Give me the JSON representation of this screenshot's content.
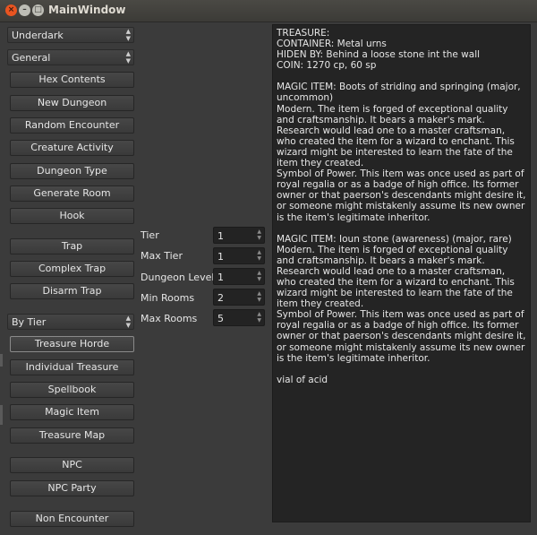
{
  "window": {
    "title": "MainWindow",
    "close_glyph": "×",
    "min_glyph": "–",
    "max_glyph": "□"
  },
  "combos": {
    "region": "Underdark",
    "category": "General",
    "treasure_mode": "By Tier"
  },
  "buttons": {
    "hex_contents": "Hex Contents",
    "new_dungeon": "New Dungeon",
    "random_encounter": "Random Encounter",
    "creature_activity": "Creature Activity",
    "dungeon_type": "Dungeon Type",
    "generate_room": "Generate Room",
    "hook": "Hook",
    "trap": "Trap",
    "complex_trap": "Complex Trap",
    "disarm_trap": "Disarm Trap",
    "treasure_horde": "Treasure Horde",
    "individual_treasure": "Individual Treasure",
    "spellbook": "Spellbook",
    "magic_item": "Magic Item",
    "treasure_map": "Treasure Map",
    "npc": "NPC",
    "npc_party": "NPC Party",
    "non_encounter": "Non Encounter"
  },
  "params": {
    "tier": {
      "label": "Tier",
      "value": "1"
    },
    "max_tier": {
      "label": "Max Tier",
      "value": "1"
    },
    "dungeon_levels": {
      "label": "Dungeon Levels",
      "value": "1"
    },
    "min_rooms": {
      "label": "Min Rooms",
      "value": "2"
    },
    "max_rooms": {
      "label": "Max Rooms",
      "value": "5"
    }
  },
  "output": {
    "lines": [
      "TREASURE:",
      "CONTAINER: Metal urns",
      "HIDEN BY: Behind a loose stone int the wall",
      "COIN: 1270 cp, 60 sp",
      "",
      "MAGIC ITEM: Boots of striding and springing (major, uncommon)",
      "Modern. The item is forged of exceptional quality and craftsmanship. It bears a maker's mark. Research would lead one to a master craftsman, who created the item for a wizard to enchant. This wizard might be interested to learn the fate of the item they created.",
      "Symbol of Power. This item was once used as part of royal regalia or as a badge of high office. Its former owner or that paerson's descendants might desire it, or someone might mistakenly assume its new owner is the item's legitimate inheritor.",
      "",
      "MAGIC ITEM: Ioun stone (awareness) (major, rare)",
      "Modern. The item is forged of exceptional quality and craftsmanship. It bears a maker's mark. Research would lead one to a master craftsman, who created the item for a wizard to enchant. This wizard might be interested to learn the fate of the item they created.",
      "Symbol of Power. This item was once used as part of royal regalia or as a badge of high office. Its former owner or that paerson's descendants might desire it, or someone might mistakenly assume its new owner is the item's legitimate inheritor.",
      "",
      "vial of acid"
    ]
  }
}
